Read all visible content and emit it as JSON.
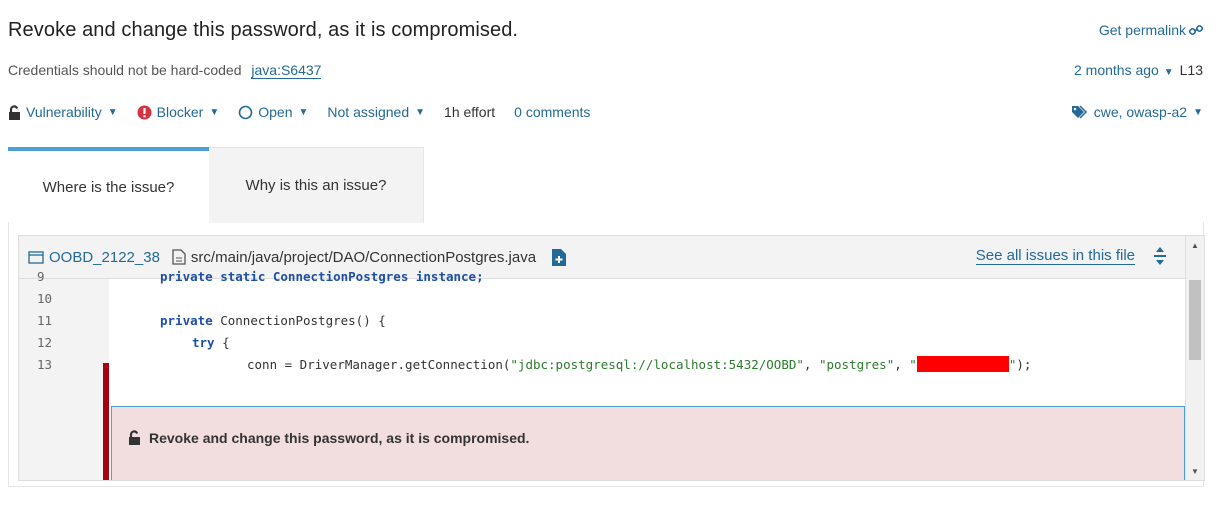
{
  "issue": {
    "title": "Revoke and change this password, as it is compromised.",
    "permalink": "Get permalink",
    "rule_text": "Credentials should not be hard-coded",
    "rule_key": "java:S6437",
    "age": "2 months ago",
    "line_ref": "L13"
  },
  "toolbar": {
    "type": "Vulnerability",
    "severity": "Blocker",
    "status": "Open",
    "assignee": "Not assigned",
    "effort": "1h effort",
    "comments": "0 comments",
    "tags": "cwe, owasp-a2"
  },
  "tabs": [
    {
      "label": "Where is the issue?"
    },
    {
      "label": "Why is this an issue?"
    }
  ],
  "viewer": {
    "project": "OOBD_2122_38",
    "file": "src/main/java/project/DAO/ConnectionPostgres.java",
    "see_all": "See all issues in this file"
  },
  "code": {
    "line9": "9",
    "line9_text": "private static ConnectionPostgres instance;",
    "line10": "10",
    "line11": "11",
    "line11_kw": "private",
    "line11_text": " ConnectionPostgres() {",
    "line12": "12",
    "line12_kw": "try",
    "line12_text": " {",
    "line13": "13",
    "line13_pre": "conn = DriverManager.getConnection(",
    "line13_s1": "\"jdbc:postgresql://localhost:5432/OOBD\"",
    "line13_mid": ", ",
    "line13_s2": "\"postgres\"",
    "line13_mid2": ", ",
    "line13_q1": "\"",
    "line13_q2": "\"",
    "line13_end": ");"
  },
  "issue_box": {
    "message": "Revoke and change this password, as it is compromised."
  },
  "colors": {
    "link": "#236a97",
    "accent": "#4b9fd5",
    "blocker": "#d4333f",
    "marker": "#a4030f",
    "issue_bg": "#f2dede"
  },
  "icons": [
    "link-icon",
    "caret-down-icon",
    "unlock-icon",
    "blocker-icon",
    "open-circle-icon",
    "tag-icon",
    "folder-icon",
    "file-icon",
    "file-plus-icon",
    "expand-icon"
  ]
}
